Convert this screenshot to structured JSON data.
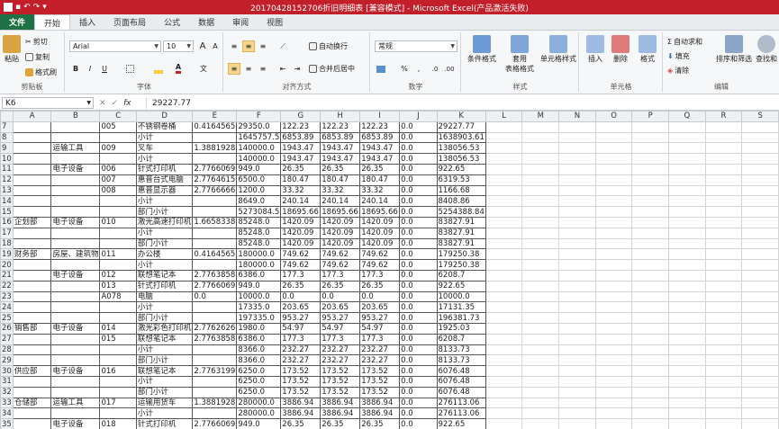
{
  "window": {
    "title": "20170428152706折旧明细表 [兼容模式] - Microsoft Excel(产品激活失败)"
  },
  "qat": {
    "icons": [
      "excel-logo-icon",
      "save-icon",
      "undo-icon",
      "redo-icon",
      "customize-icon"
    ],
    "undo_glyph": "↶",
    "redo_glyph": "↷",
    "save_glyph": "▪",
    "more_glyph": "▾"
  },
  "tabs": [
    {
      "label": "文件"
    },
    {
      "label": "开始"
    },
    {
      "label": "插入"
    },
    {
      "label": "页面布局"
    },
    {
      "label": "公式"
    },
    {
      "label": "数据"
    },
    {
      "label": "审阅"
    },
    {
      "label": "视图"
    }
  ],
  "ribbon": {
    "clipboard": {
      "paste": "粘贴",
      "cut": "剪切",
      "copy": "复制",
      "format_painter": "格式刷",
      "group": "剪贴板"
    },
    "font": {
      "name": "Arial",
      "size": "10",
      "bold": "B",
      "italic": "I",
      "underline": "U",
      "grow": "A",
      "shrink": "A",
      "group": "字体",
      "font_color": "#d11f1f",
      "fill_color": "#f5d336"
    },
    "alignment": {
      "wrap": "自动换行",
      "merge": "合并后居中",
      "group": "对齐方式"
    },
    "number": {
      "format": "常规",
      "percent": "%",
      "comma": ",",
      "group": "数字"
    },
    "styles": {
      "conditional": "条件格式",
      "table": "套用\n表格格式",
      "cell": "单元格样式",
      "group": "样式"
    },
    "cells": {
      "insert": "插入",
      "delete": "删除",
      "format": "格式",
      "group": "单元格"
    },
    "editing": {
      "autosum": "自动求和",
      "fill": "填充",
      "clear": "清除",
      "sort": "排序和筛选",
      "find": "查找和",
      "group": "编辑"
    }
  },
  "formula_bar": {
    "cell_ref": "K6",
    "fx": "fx",
    "value": "29227.77"
  },
  "columns": [
    "A",
    "B",
    "C",
    "D",
    "E",
    "F",
    "G",
    "H",
    "I",
    "J",
    "K",
    "L",
    "M",
    "N",
    "O",
    "P",
    "Q",
    "R",
    "S"
  ],
  "rows": [
    {
      "n": "7",
      "c": [
        "",
        "",
        "005",
        "不锈钢卷桶",
        "0.4164565",
        "29350.0",
        "122.23",
        "122.23",
        "122.23",
        "0.0",
        "29227.77"
      ]
    },
    {
      "n": "8",
      "c": [
        "",
        "",
        "",
        "小计",
        "",
        "1645757.5",
        "6853.89",
        "6853.89",
        "6853.89",
        "0.0",
        "1638903.61"
      ]
    },
    {
      "n": "9",
      "c": [
        "",
        "运输工具",
        "009",
        "叉车",
        "1.3881928",
        "140000.0",
        "1943.47",
        "1943.47",
        "1943.47",
        "0.0",
        "138056.53"
      ]
    },
    {
      "n": "10",
      "c": [
        "",
        "",
        "",
        "小计",
        "",
        "140000.0",
        "1943.47",
        "1943.47",
        "1943.47",
        "0.0",
        "138056.53"
      ]
    },
    {
      "n": "11",
      "c": [
        "",
        "电子设备",
        "006",
        "针式打印机",
        "2.7766069",
        "949.0",
        "26.35",
        "26.35",
        "26.35",
        "0.0",
        "922.65"
      ]
    },
    {
      "n": "12",
      "c": [
        "",
        "",
        "007",
        "惠普台式电脑",
        "2.7764615",
        "6500.0",
        "180.47",
        "180.47",
        "180.47",
        "0.0",
        "6319.53"
      ]
    },
    {
      "n": "13",
      "c": [
        "",
        "",
        "008",
        "惠普显示器",
        "2.7766666",
        "1200.0",
        "33.32",
        "33.32",
        "33.32",
        "0.0",
        "1166.68"
      ]
    },
    {
      "n": "14",
      "c": [
        "",
        "",
        "",
        "小计",
        "",
        "8649.0",
        "240.14",
        "240.14",
        "240.14",
        "0.0",
        "8408.86"
      ]
    },
    {
      "n": "15",
      "c": [
        "",
        "",
        "",
        "部门小计",
        "",
        "5273084.5",
        "18695.66",
        "18695.66",
        "18695.66",
        "0.0",
        "5254388.84"
      ]
    },
    {
      "n": "16",
      "c": [
        "企划部",
        "电子设备",
        "010",
        "激光高速打印机",
        "1.6658338",
        "85248.0",
        "1420.09",
        "1420.09",
        "1420.09",
        "0.0",
        "83827.91"
      ]
    },
    {
      "n": "17",
      "c": [
        "",
        "",
        "",
        "小计",
        "",
        "85248.0",
        "1420.09",
        "1420.09",
        "1420.09",
        "0.0",
        "83827.91"
      ]
    },
    {
      "n": "18",
      "c": [
        "",
        "",
        "",
        "部门小计",
        "",
        "85248.0",
        "1420.09",
        "1420.09",
        "1420.09",
        "0.0",
        "83827.91"
      ]
    },
    {
      "n": "19",
      "c": [
        "财务部",
        "房屋、建筑物",
        "011",
        "办公楼",
        "0.4164565",
        "180000.0",
        "749.62",
        "749.62",
        "749.62",
        "0.0",
        "179250.38"
      ]
    },
    {
      "n": "20",
      "c": [
        "",
        "",
        "",
        "小计",
        "",
        "180000.0",
        "749.62",
        "749.62",
        "749.62",
        "0.0",
        "179250.38"
      ]
    },
    {
      "n": "21",
      "c": [
        "",
        "电子设备",
        "012",
        "联想笔记本",
        "2.7763858",
        "6386.0",
        "177.3",
        "177.3",
        "177.3",
        "0.0",
        "6208.7"
      ]
    },
    {
      "n": "22",
      "c": [
        "",
        "",
        "013",
        "针式打印机",
        "2.7766069",
        "949.0",
        "26.35",
        "26.35",
        "26.35",
        "0.0",
        "922.65"
      ]
    },
    {
      "n": "23",
      "c": [
        "",
        "",
        "A078",
        "电脑",
        "0.0",
        "10000.0",
        "0.0",
        "0.0",
        "0.0",
        "0.0",
        "10000.0"
      ]
    },
    {
      "n": "24",
      "c": [
        "",
        "",
        "",
        "小计",
        "",
        "17335.0",
        "203.65",
        "203.65",
        "203.65",
        "0.0",
        "17131.35"
      ]
    },
    {
      "n": "25",
      "c": [
        "",
        "",
        "",
        "部门小计",
        "",
        "197335.0",
        "953.27",
        "953.27",
        "953.27",
        "0.0",
        "196381.73"
      ]
    },
    {
      "n": "26",
      "c": [
        "销售部",
        "电子设备",
        "014",
        "激光彩色打印机",
        "2.7762626",
        "1980.0",
        "54.97",
        "54.97",
        "54.97",
        "0.0",
        "1925.03"
      ]
    },
    {
      "n": "27",
      "c": [
        "",
        "",
        "015",
        "联想笔记本",
        "2.7763858",
        "6386.0",
        "177.3",
        "177.3",
        "177.3",
        "0.0",
        "6208.7"
      ]
    },
    {
      "n": "28",
      "c": [
        "",
        "",
        "",
        "小计",
        "",
        "8366.0",
        "232.27",
        "232.27",
        "232.27",
        "0.0",
        "8133.73"
      ]
    },
    {
      "n": "29",
      "c": [
        "",
        "",
        "",
        "部门小计",
        "",
        "8366.0",
        "232.27",
        "232.27",
        "232.27",
        "0.0",
        "8133.73"
      ]
    },
    {
      "n": "30",
      "c": [
        "供应部",
        "电子设备",
        "016",
        "联想笔记本",
        "2.7763199",
        "6250.0",
        "173.52",
        "173.52",
        "173.52",
        "0.0",
        "6076.48"
      ]
    },
    {
      "n": "31",
      "c": [
        "",
        "",
        "",
        "小计",
        "",
        "6250.0",
        "173.52",
        "173.52",
        "173.52",
        "0.0",
        "6076.48"
      ]
    },
    {
      "n": "32",
      "c": [
        "",
        "",
        "",
        "部门小计",
        "",
        "6250.0",
        "173.52",
        "173.52",
        "173.52",
        "0.0",
        "6076.48"
      ]
    },
    {
      "n": "33",
      "c": [
        "仓储部",
        "运输工具",
        "017",
        "运输用货车",
        "1.3881928",
        "280000.0",
        "3886.94",
        "3886.94",
        "3886.94",
        "0.0",
        "276113.06"
      ]
    },
    {
      "n": "34",
      "c": [
        "",
        "",
        "",
        "小计",
        "",
        "280000.0",
        "3886.94",
        "3886.94",
        "3886.94",
        "0.0",
        "276113.06"
      ]
    },
    {
      "n": "35",
      "c": [
        "",
        "电子设备",
        "018",
        "针式打印机",
        "2.7766069",
        "949.0",
        "26.35",
        "26.35",
        "26.35",
        "0.0",
        "922.65"
      ]
    }
  ]
}
